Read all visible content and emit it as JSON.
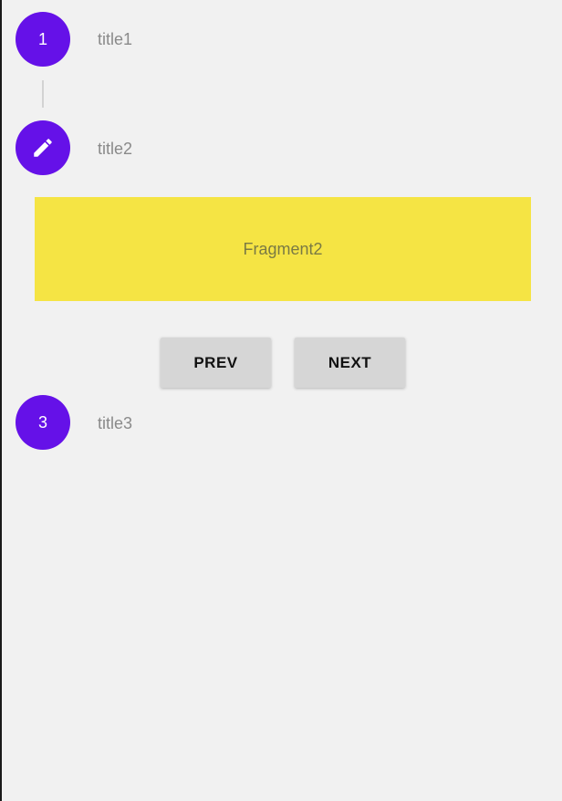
{
  "theme": {
    "accent": "#6511e8",
    "fragment_bg": "#f5e444",
    "background": "#f1f1f1",
    "button_bg": "#d6d6d6"
  },
  "steps": [
    {
      "indicator": "1",
      "title": "title1",
      "state": "complete"
    },
    {
      "indicator_icon": "pencil-icon",
      "title": "title2",
      "state": "active"
    },
    {
      "indicator": "3",
      "title": "title3",
      "state": "pending"
    }
  ],
  "active_step": {
    "fragment_label": "Fragment2",
    "prev_label": "PREV",
    "next_label": "NEXT"
  }
}
